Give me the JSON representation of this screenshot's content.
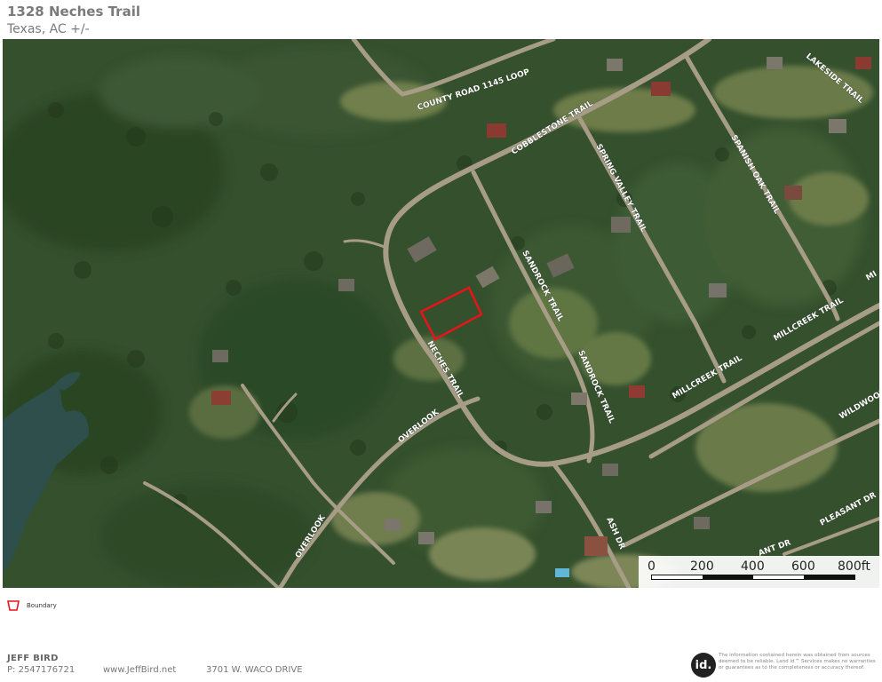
{
  "header": {
    "title": "1328 Neches Trail",
    "subtitle": "Texas,  AC +/-"
  },
  "map": {
    "road_labels": {
      "county_road": "COUNTY ROAD 1145 LOOP",
      "cobblestone": "COBBLESTONE TRAIL",
      "spring_valley": "SPRING VALLEY TRAIL",
      "spanish_oak": "SPANISH OAK TRAIL",
      "lakeside": "LAKESIDE TRAIL",
      "sandrock_1": "SANDROCK TRAIL",
      "sandrock_2": "SANDROCK TRAIL",
      "neches": "NECHES TRAIL",
      "millcreek_1": "MILLCREEK TRAIL",
      "millcreek_2": "MILLCREEK TRAIL",
      "overlook_1": "OVERLOOK",
      "overlook_2": "OVERLOOK",
      "wildwood": "WILDWOOD",
      "ash": "ASH DR",
      "pleasant": "PLEASANT DR",
      "ant_dr": "ANT DR",
      "edge_mi": "MI"
    },
    "boundary_color": "#e8141a",
    "scale": {
      "labels": [
        "0",
        "200",
        "400",
        "600",
        "800ft"
      ]
    }
  },
  "legend": {
    "boundary_icon": "boundary-polygon-icon",
    "boundary_label": "Boundary"
  },
  "footer": {
    "agent_name": "JEFF BIRD",
    "phone": "P: 2547176721",
    "website": "www.JeffBird.net",
    "address": "3701 W. WACO DRIVE",
    "logo_text": "id.",
    "disclaimer": "The information contained herein was obtained from sources deemed to be reliable. Land id™ Services makes no warranties or guarantees as to the completeness or accuracy thereof."
  }
}
